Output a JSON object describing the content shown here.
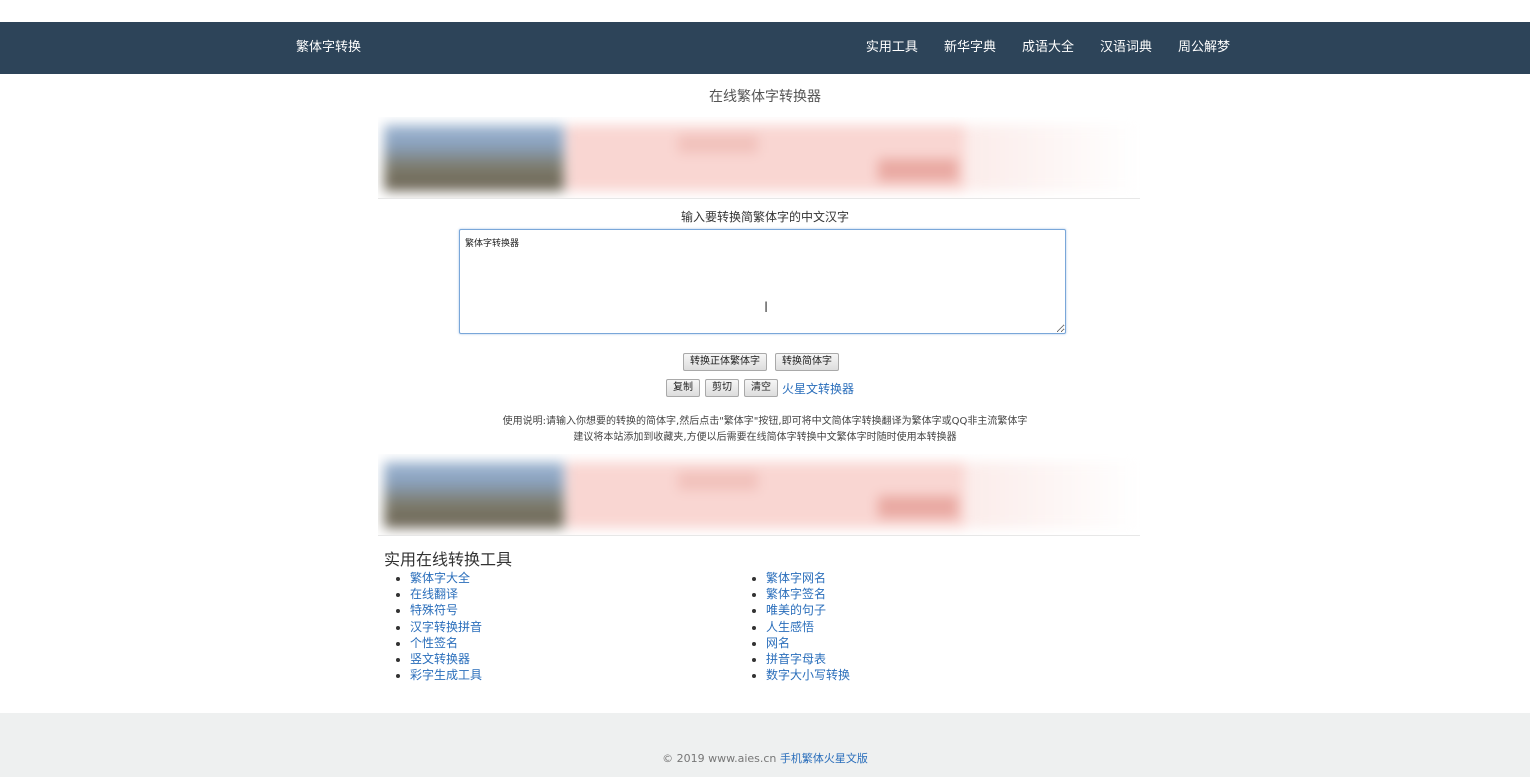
{
  "navbar": {
    "brand": "繁体字转换",
    "links": [
      "实用工具",
      "新华字典",
      "成语大全",
      "汉语词典",
      "周公解梦"
    ]
  },
  "main": {
    "title": "在线繁体字转换器",
    "input_label": "输入要转换简繁体字的中文汉字",
    "textarea_value": "繁体字转换器",
    "buttons": {
      "to_traditional": "转换正体繁体字",
      "to_simplified": "转换简体字",
      "copy": "复制",
      "cut": "剪切",
      "clear": "清空"
    },
    "mars_link": "火星文转换器",
    "instructions": [
      "使用说明:请输入你想要的转换的简体字,然后点击\"繁体字\"按钮,即可将中文简体字转换翻译为繁体字或QQ非主流繁体字",
      "建议将本站添加到收藏夹,方便以后需要在线简体字转换中文繁体字时随时使用本转换器"
    ]
  },
  "tools": {
    "heading": "实用在线转换工具",
    "left": [
      "繁体字大全",
      "在线翻译",
      "特殊符号",
      "汉字转换拼音",
      "个性签名",
      "竖文转换器",
      "彩字生成工具"
    ],
    "right": [
      "繁体字网名",
      "繁体字签名",
      "唯美的句子",
      "人生感悟",
      "网名",
      "拼音字母表",
      "数字大小写转换"
    ]
  },
  "footer": {
    "copyright": "© 2019 www.aies.cn",
    "link": "手机繁体火星文版"
  },
  "colors": {
    "navbar": "#2d4459",
    "link": "#2a6ebb",
    "footer": "#eef0f0"
  }
}
